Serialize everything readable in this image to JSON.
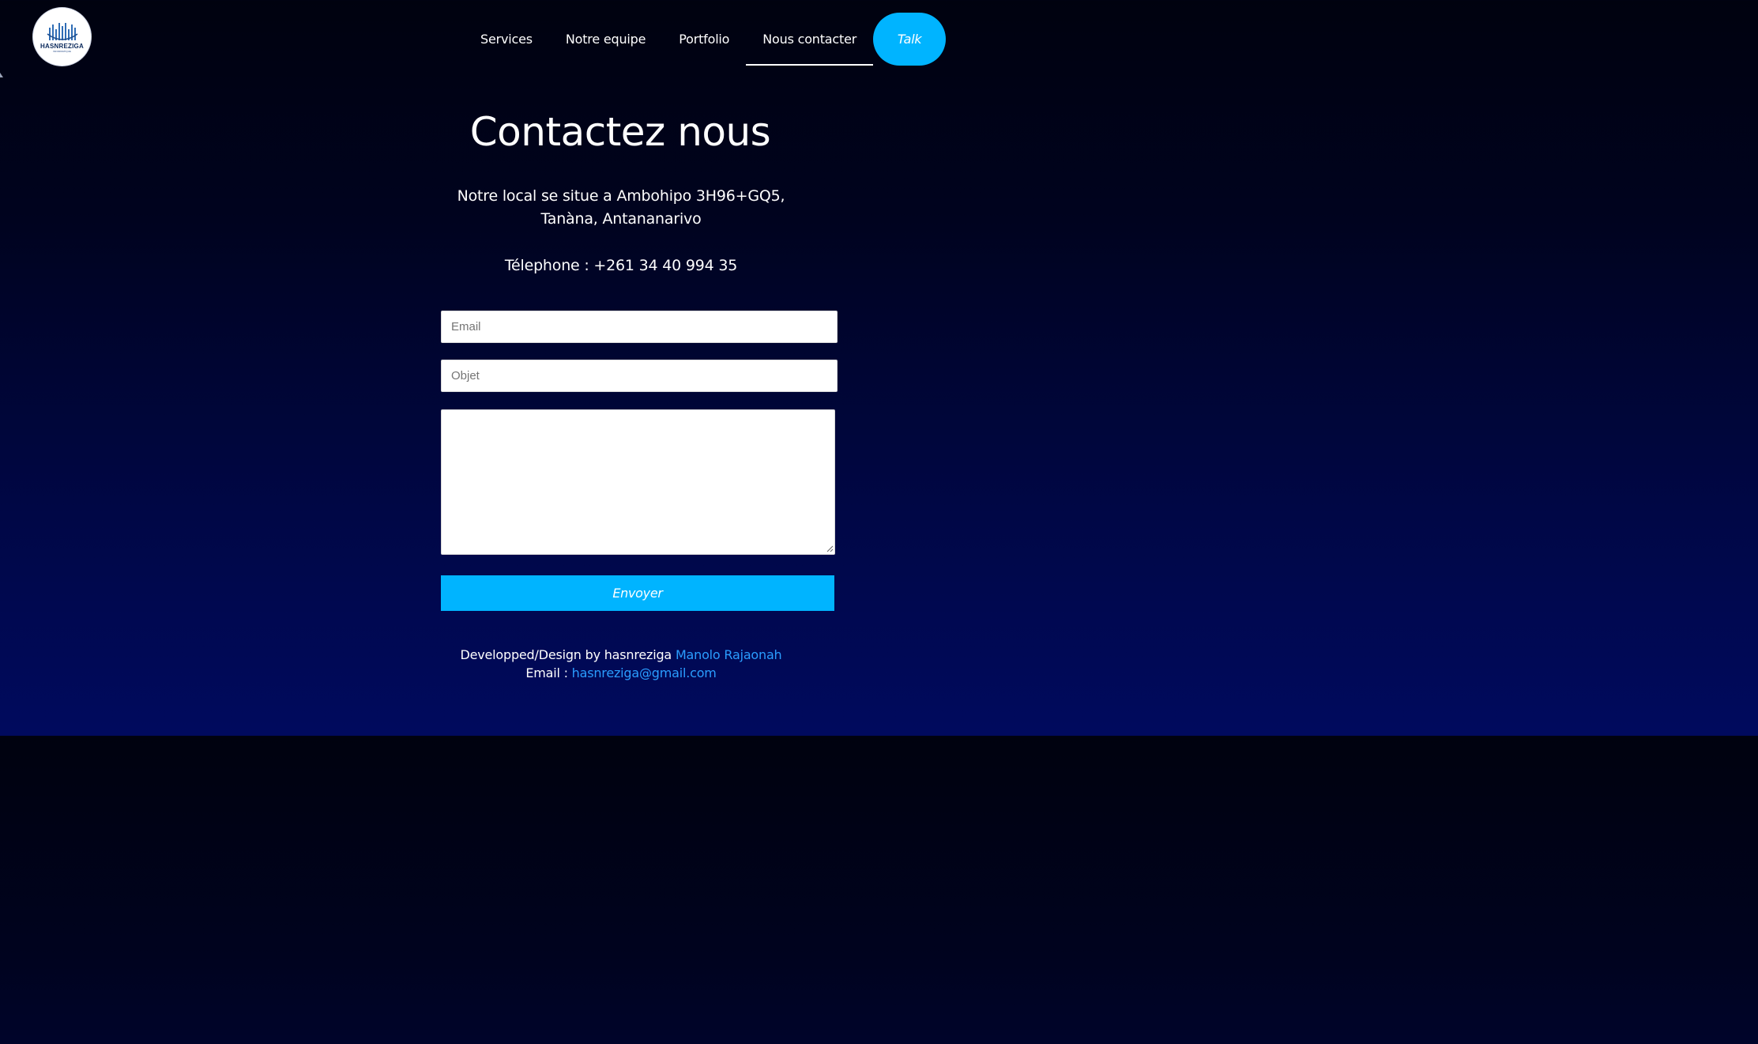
{
  "logo": {
    "text": "HASNREZIGA",
    "subtext": "INFORMATIQUE"
  },
  "nav": {
    "items": [
      {
        "label": "Services"
      },
      {
        "label": "Notre equipe"
      },
      {
        "label": "Portfolio"
      },
      {
        "label": "Nous contacter",
        "active": true
      }
    ],
    "cta_label": "Talk"
  },
  "contact": {
    "title": "Contactez nous",
    "address_line1": "Notre local se situe a Ambohipo 3H96+GQ5,",
    "address_line2": "Tanàna, Antananarivo",
    "phone": "Télephone : +261 34 40 994 35"
  },
  "form": {
    "email_placeholder": "Email",
    "subject_placeholder": "Objet",
    "message_value": "",
    "submit_label": "Envoyer"
  },
  "footer": {
    "credit_prefix": "Developped/Design by hasnreziga",
    "credit_link": "Manolo Rajaonah",
    "email_prefix": "Email :",
    "email_link": "hasnreziga@gmail.com"
  },
  "colors": {
    "accent": "#00b4ff",
    "link": "#2a9dff",
    "background_top": "#00020f",
    "background_bottom": "#000a5e"
  }
}
